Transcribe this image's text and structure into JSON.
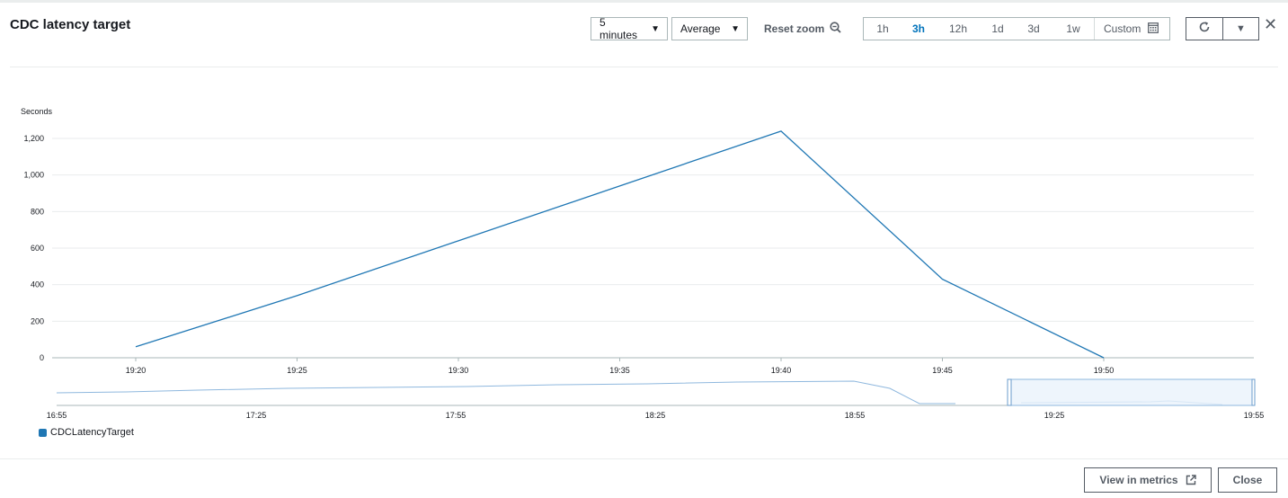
{
  "header": {
    "title": "CDC latency target",
    "period": "5 minutes",
    "statistic": "Average",
    "reset_zoom": "Reset zoom",
    "ranges": [
      "1h",
      "3h",
      "12h",
      "1d",
      "3d",
      "1w"
    ],
    "active_range": "3h",
    "custom": "Custom"
  },
  "footer": {
    "view_in_metrics": "View in metrics",
    "close": "Close"
  },
  "colors": {
    "series": "#1f77b4",
    "accent": "#0073bb"
  },
  "icons": [
    "caret-down-icon",
    "zoom-out-icon",
    "calendar-icon",
    "refresh-icon",
    "close-icon",
    "external-link-icon"
  ],
  "chart_data": {
    "type": "line",
    "ylabel": "Seconds",
    "x": [
      "19:20",
      "19:25",
      "19:30",
      "19:35",
      "19:40",
      "19:45",
      "19:50"
    ],
    "xticks": [
      "19:20",
      "19:25",
      "19:30",
      "19:35",
      "19:40",
      "19:45",
      "19:50"
    ],
    "yticks": [
      "0",
      "200",
      "400",
      "600",
      "800",
      "1,000",
      "1,200"
    ],
    "ylim": [
      0,
      1200
    ],
    "series": [
      {
        "name": "CDCLatencyTarget",
        "values": [
          60,
          340,
          640,
          940,
          1240,
          430,
          0
        ]
      }
    ],
    "grid": true,
    "legend": "bottom-left",
    "navigator": {
      "xticks": [
        "16:55",
        "17:25",
        "17:55",
        "18:25",
        "18:55",
        "19:25",
        "19:55"
      ],
      "selection": [
        "19:15",
        "19:55"
      ]
    }
  }
}
